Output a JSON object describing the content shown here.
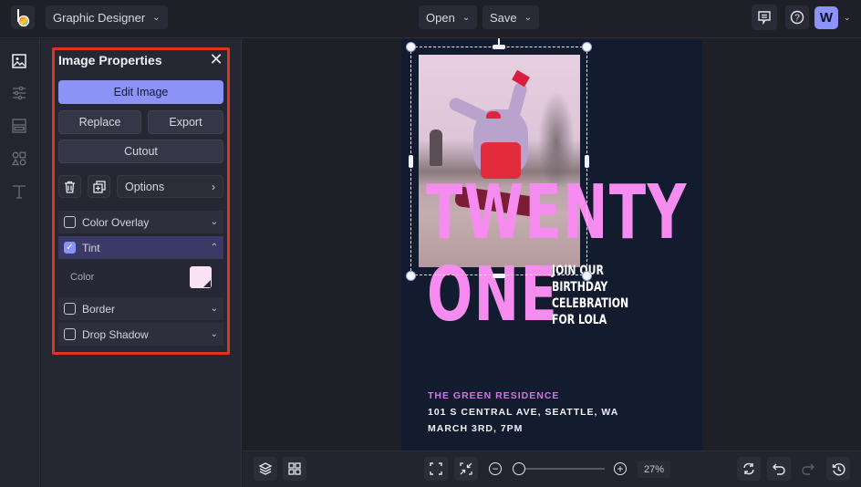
{
  "topbar": {
    "app_name": "Graphic Designer",
    "open_label": "Open",
    "save_label": "Save",
    "avatar_initial": "W",
    "icons": [
      "befunky-logo-icon",
      "comment-icon",
      "help-icon",
      "chevron-down-icon"
    ]
  },
  "leftnav": {
    "items": [
      {
        "name": "image-icon",
        "active": true
      },
      {
        "name": "sliders-icon",
        "active": false
      },
      {
        "name": "layout-icon",
        "active": false
      },
      {
        "name": "shapes-icon",
        "active": false
      },
      {
        "name": "text-icon",
        "active": false
      }
    ]
  },
  "panel": {
    "title": "Image Properties",
    "close_icon": "close-icon",
    "edit_image": "Edit Image",
    "replace": "Replace",
    "export": "Export",
    "cutout": "Cutout",
    "options": "Options",
    "accordions": [
      {
        "label": "Color Overlay",
        "checked": false,
        "expanded": false
      },
      {
        "label": "Tint",
        "checked": true,
        "expanded": true
      },
      {
        "label": "Border",
        "checked": false,
        "expanded": false
      },
      {
        "label": "Drop Shadow",
        "checked": false,
        "expanded": false
      }
    ],
    "tint_color_label": "Color",
    "tint_color": "#fbe3f5"
  },
  "design": {
    "headline_1": "TWENTY",
    "headline_2": "ONE",
    "invite_lines": [
      "JOIN OUR",
      "BIRTHDAY",
      "CELEBRATION",
      "FOR LOLA"
    ],
    "venue": "THE GREEN RESIDENCE",
    "address": "101 S CENTRAL AVE, SEATTLE, WA",
    "date": "MARCH 3RD, 7PM",
    "colors": {
      "background": "#131c2f",
      "accent_pink": "#f78cf0",
      "venue_purple": "#d474e0"
    }
  },
  "bottombar": {
    "zoom_value": "27%",
    "zoom_fraction": 0.05
  },
  "colors": {
    "accent": "#8b93f7",
    "highlight_border": "#e0341c"
  }
}
